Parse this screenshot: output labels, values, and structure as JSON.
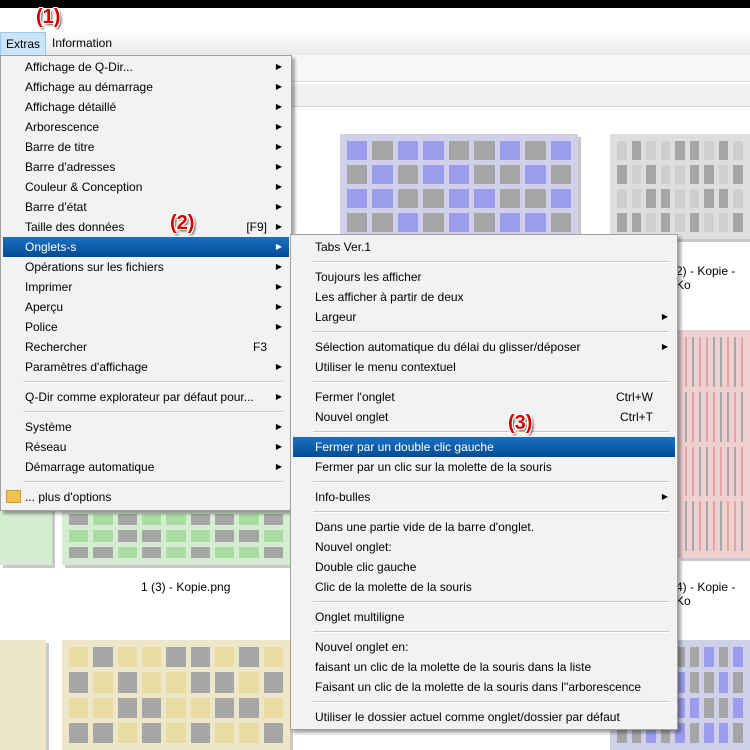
{
  "menubar": {
    "extras": "Extras",
    "information": "Information"
  },
  "annotations": {
    "a1": "(1)",
    "a2": "(2)",
    "a3": "(3)"
  },
  "colors": {
    "highlight": "#0b5aa8",
    "annotation": "#d40000",
    "thumb_blue": "#9b9bea",
    "thumb_gray": "#cfcfcf",
    "thumb_red": "#e8a0a0",
    "thumb_green": "#a8dca0",
    "thumb_yellow": "#e9dca0"
  },
  "captions": {
    "c1": "2) - Kopie - Ko",
    "c2": "1 (3) - Kopie.png",
    "c3": "4) - Kopie - Ko"
  },
  "extras_menu": {
    "items": [
      {
        "label": "Affichage de Q-Dir..."
      },
      {
        "label": "Affichage au démarrage"
      },
      {
        "label": "Affichage détaillé"
      },
      {
        "label": "Arborescence"
      },
      {
        "label": "Barre de titre"
      },
      {
        "label": "Barre d'adresses"
      },
      {
        "label": "Couleur & Conception"
      },
      {
        "label": "Barre d'état"
      },
      {
        "label": "Taille des données",
        "shortcut": "[F9]"
      },
      {
        "label": "Onglets-s"
      },
      {
        "label": "Opérations sur les fichiers"
      },
      {
        "label": "Imprimer"
      },
      {
        "label": "Aperçu"
      },
      {
        "label": "Police"
      },
      {
        "label": "Rechercher",
        "shortcut": "F3"
      },
      {
        "label": "Paramètres d'affichage"
      },
      {
        "label": "Q-Dir comme explorateur par défaut pour..."
      },
      {
        "label": "Système"
      },
      {
        "label": "Réseau"
      },
      {
        "label": "Démarrage automatique"
      },
      {
        "label": "... plus d'options"
      }
    ]
  },
  "tabs_menu": {
    "items": [
      {
        "label": "Tabs Ver.1"
      },
      {
        "label": "Toujours les afficher"
      },
      {
        "label": "Les afficher à partir de deux"
      },
      {
        "label": "Largeur"
      },
      {
        "label": "Sélection automatique du délai du glisser/déposer"
      },
      {
        "label": "Utiliser le menu contextuel"
      },
      {
        "label": "Fermer l'onglet",
        "shortcut": "Ctrl+W"
      },
      {
        "label": "Nouvel onglet",
        "shortcut": "Ctrl+T"
      },
      {
        "label": "Fermer par un double clic gauche"
      },
      {
        "label": "Fermer par un clic sur la molette de la souris"
      },
      {
        "label": "Info-bulles"
      },
      {
        "label": "Dans une partie vide de la barre d'onglet."
      },
      {
        "label": "Nouvel onglet:"
      },
      {
        "label": "Double clic gauche"
      },
      {
        "label": "Clic de la molette de la souris"
      },
      {
        "label": "Onglet multiligne"
      },
      {
        "label": "Nouvel onglet en:"
      },
      {
        "label": "faisant un clic de la molette de la souris dans la liste"
      },
      {
        "label": "Faisant un clic de la molette de la souris dans l''arborescence"
      },
      {
        "label": "Utiliser le dossier actuel comme onglet/dossier par défaut"
      }
    ]
  }
}
